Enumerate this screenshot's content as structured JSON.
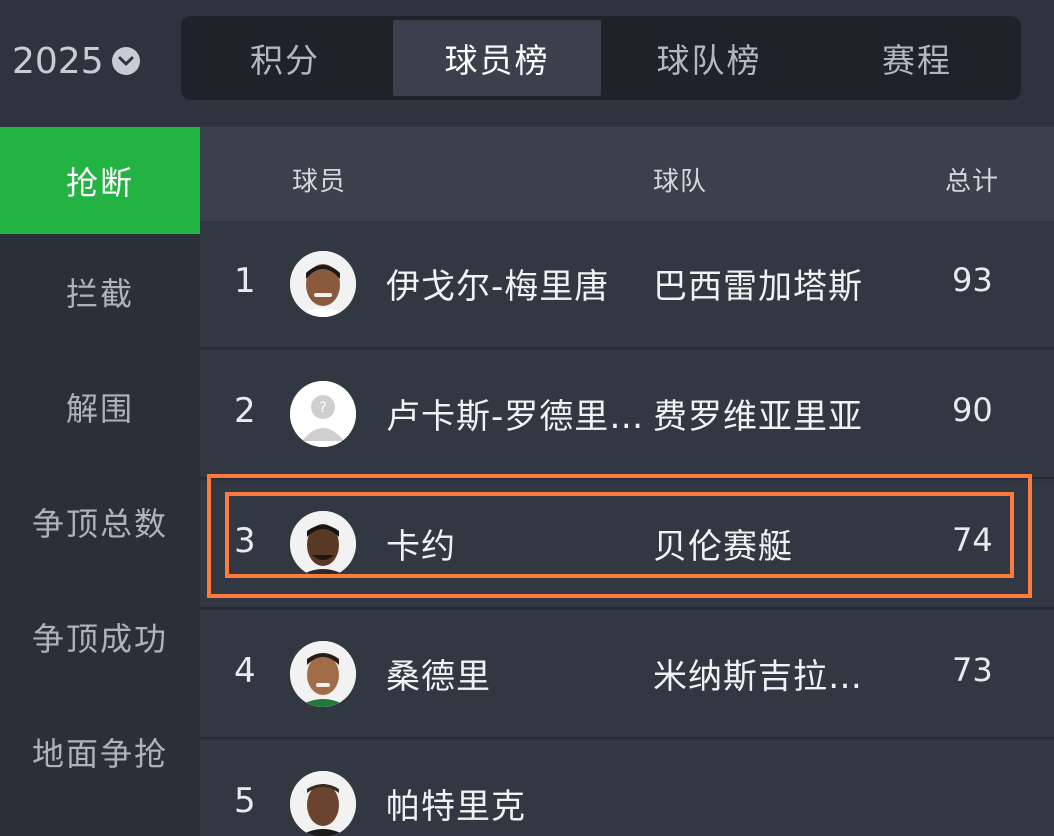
{
  "season": {
    "year": "2025"
  },
  "tabs": [
    {
      "label": "积分"
    },
    {
      "label": "球员榜"
    },
    {
      "label": "球队榜"
    },
    {
      "label": "赛程"
    }
  ],
  "sidebar": [
    {
      "label": "抢断"
    },
    {
      "label": "拦截"
    },
    {
      "label": "解围"
    },
    {
      "label": "争顶总数"
    },
    {
      "label": "争顶成功"
    },
    {
      "label": "地面争抢"
    }
  ],
  "table": {
    "headers": {
      "player": "球员",
      "team": "球队",
      "total": "总计"
    },
    "rows": [
      {
        "rank": "1",
        "player": "伊戈尔-梅里唐",
        "team": "巴西雷加塔斯",
        "total": "93"
      },
      {
        "rank": "2",
        "player": "卢卡斯-罗德里…",
        "team": "费罗维亚里亚",
        "total": "90"
      },
      {
        "rank": "3",
        "player": "卡约",
        "team": "贝伦赛艇",
        "total": "74"
      },
      {
        "rank": "4",
        "player": "桑德里",
        "team": "米纳斯吉拉…",
        "total": "73"
      },
      {
        "rank": "5",
        "player": "帕特里克",
        "team": "",
        "total": ""
      }
    ]
  },
  "colors": {
    "accent_green": "#23b343",
    "highlight_orange": "#ff7a3d"
  }
}
